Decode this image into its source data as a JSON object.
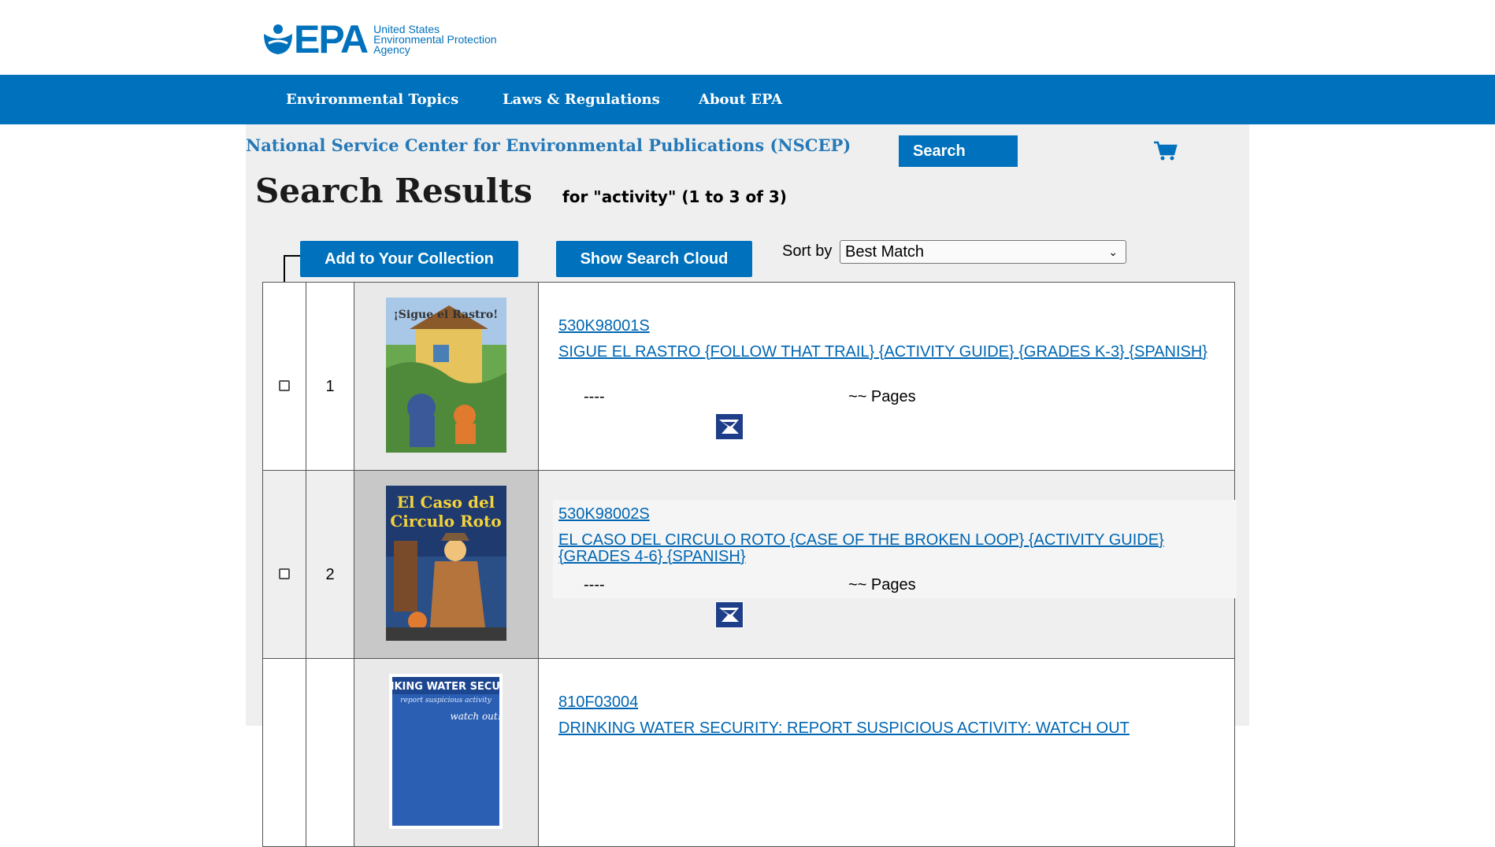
{
  "header": {
    "logo_text": "EPA",
    "agency_line1": "United States",
    "agency_line2": "Environmental Protection",
    "agency_line3": "Agency"
  },
  "nav": {
    "items": [
      "Environmental Topics",
      "Laws & Regulations",
      "About EPA"
    ]
  },
  "nscep": {
    "title": "National Service Center for Environmental Publications (NSCEP)",
    "search_label": "Search"
  },
  "results": {
    "heading": "Search Results",
    "summary": "for \"activity\" (1 to 3 of 3)"
  },
  "toolbar": {
    "add_label": "Add to Your Collection",
    "cloud_label": "Show Search Cloud",
    "sort_label": "Sort by",
    "sort_value": "Best Match"
  },
  "rows": [
    {
      "num": "1",
      "id": "530K98001S",
      "title": "SIGUE EL RASTRO {FOLLOW THAT TRAIL} {ACTIVITY GUIDE} {GRADES K-3} {SPANISH}",
      "date": "----",
      "pages": "~~ Pages"
    },
    {
      "num": "2",
      "id": "530K98002S",
      "title": "EL CASO DEL CIRCULO ROTO {CASE OF THE BROKEN LOOP} {ACTIVITY GUIDE} {GRADES 4-6} {SPANISH}",
      "date": "----",
      "pages": "~~ Pages"
    },
    {
      "num": "",
      "id": "810F03004",
      "title": "DRINKING WATER SECURITY: REPORT SUSPICIOUS ACTIVITY: WATCH OUT",
      "date": "",
      "pages": ""
    }
  ],
  "colors": {
    "brand": "#0071bc",
    "link": "#0066b3",
    "panel": "#efefef"
  }
}
